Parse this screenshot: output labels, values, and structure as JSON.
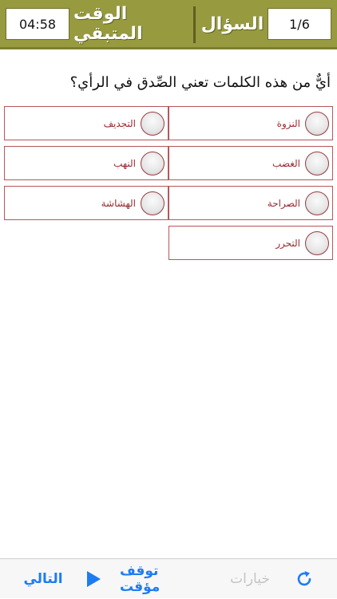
{
  "header": {
    "timer": "04:58",
    "time_label": "الوقت المتبقي",
    "question_label": "السؤال",
    "counter": "1/6"
  },
  "question": {
    "text": "أيٌّ من هذه الكلمات تعني الصِّدق في الرأي؟"
  },
  "options": [
    {
      "label": "النزوة"
    },
    {
      "label": "التجديف"
    },
    {
      "label": "الغضب"
    },
    {
      "label": "النهب"
    },
    {
      "label": "الصراحة"
    },
    {
      "label": "الهشاشة"
    },
    {
      "label": "التحرر"
    }
  ],
  "toolbar": {
    "next_label": "التالي",
    "play_icon": "play-icon",
    "pause_timer_label": "توقف مؤقت",
    "options_label": "خيارات",
    "refresh_icon": "refresh-icon"
  },
  "colors": {
    "header_bg": "#979a3f",
    "option_border": "#b5565b",
    "option_text": "#9a2a30",
    "toolbar_accent": "#1e7cf2",
    "toolbar_disabled": "#c4c4c4"
  }
}
